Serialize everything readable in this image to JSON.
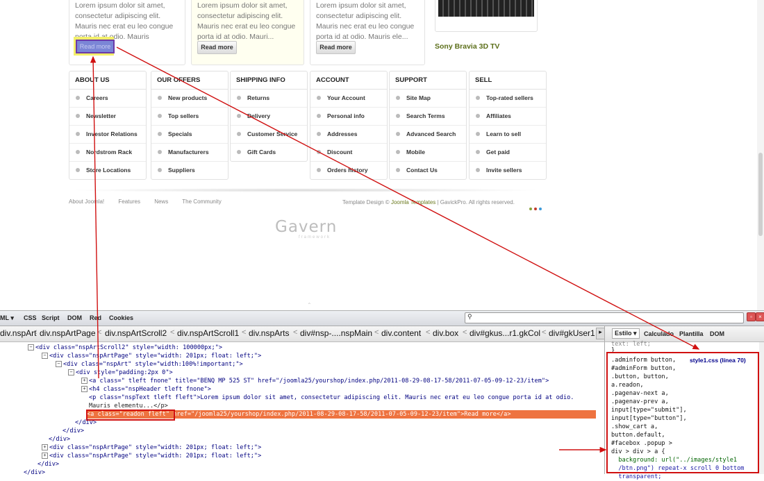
{
  "articles": [
    {
      "text": "Lorem ipsum dolor sit amet, consectetur adipiscing elit. Mauris nec erat eu leo congue porta id at odio. Mauris elementu...",
      "button": "Read more"
    },
    {
      "text": "Lorem ipsum dolor sit amet, consectetur adipiscing elit. Mauris nec erat eu leo congue porta id at odio. Mauri...",
      "button": "Read more"
    },
    {
      "text": "Lorem ipsum dolor sit amet, consectetur adipiscing elit. Mauris nec erat eu leo congue porta id at odio. Mauris ele...",
      "button": "Read more"
    }
  ],
  "product": {
    "title": "Sony Bravia 3D TV"
  },
  "footer_columns": [
    {
      "title": "ABOUT US",
      "items": [
        "Careers",
        "Newsletter",
        "Investor Relations",
        "Nordstrom Rack",
        "Store Locations"
      ]
    },
    {
      "title": "OUR OFFERS",
      "items": [
        "New products",
        "Top sellers",
        "Specials",
        "Manufacturers",
        "Suppliers"
      ]
    },
    {
      "title": "SHIPPING INFO",
      "items": [
        "Returns",
        "Delivery",
        "Customer Service",
        "Gift Cards"
      ]
    },
    {
      "title": "ACCOUNT",
      "items": [
        "Your Account",
        "Personal info",
        "Addresses",
        "Discount",
        "Orders history"
      ]
    },
    {
      "title": "SUPPORT",
      "items": [
        "Site Map",
        "Search Terms",
        "Advanced Search",
        "Mobile",
        "Contact Us"
      ]
    },
    {
      "title": "SELL",
      "items": [
        "Top-rated sellers",
        "Affiliates",
        "Learn to sell",
        "Get paid",
        "Invite sellers"
      ]
    }
  ],
  "footer_links": [
    "About Joomla!",
    "Features",
    "News",
    "The Community"
  ],
  "copyright": {
    "prefix": "Template Design © ",
    "link": "Joomla Templates",
    "suffix": " | GavickPro. All rights reserved."
  },
  "logo": {
    "name": "Gavern",
    "sub": "framework"
  },
  "colors": {
    "accent_red": "#d01010",
    "selection": "#ee7340",
    "dot1": "#8aa23a",
    "dot2": "#c0392b",
    "dot3": "#3a9ad9"
  },
  "firebug": {
    "toolbar_tabs": [
      "ML ▾",
      "CSS",
      "Script",
      "DOM",
      "Red",
      "Cookies"
    ],
    "breadcrumb": [
      "div.nspArt",
      "div.nspArtPage",
      "div.nspArtScroll2",
      "div.nspArtScroll1",
      "div.nspArts",
      "div#nsp-....nspMain",
      "div.content",
      "div.box",
      "div#gkus...r1.gkCol",
      "div#gkUser1"
    ],
    "side_tabs": [
      "Estilo ▾",
      "Calculado",
      "Plantilla",
      "DOM"
    ],
    "html_lines": [
      "<div class=\"nspArtScroll2\" style=\"width: 100000px;\">",
      "<div class=\"nspArtPage\" style=\"width: 201px; float: left;\">",
      "<div class=\"nspArt\" style=\"width:100%!important;\">",
      "<div style=\"padding:2px 0\">",
      "<a class=\" tleft fnone\" title=\"BENQ MP 525 ST\" href=\"/joomla25/yourshop/index.php/2011-08-29-08-17-58/2011-07-05-09-12-23/item\">",
      "<h4 class=\"nspHeader tleft fnone\">",
      "<p class=\"nspText tleft fleft\">Lorem ipsum dolor sit amet, consectetur adipiscing elit. Mauris nec erat eu leo congue porta id at odio.",
      "Mauris elementu...</p>",
      "<a class=\"readon fleft\" href=\"/joomla25/yourshop/index.php/2011-08-29-08-17-58/2011-07-05-09-12-23/item\">Read more</a>",
      "</div>",
      "</div>",
      "</div>",
      "<div class=\"nspArtPage\" style=\"width: 201px; float: left;\">",
      "<div class=\"nspArtPage\" style=\"width: 201px; float: left;\">",
      "</div>",
      "</div>"
    ],
    "css_top": [
      "text: left;",
      "}"
    ],
    "css_source": "style1.css (línea 70)",
    "css_rule": [
      ".adminform button,",
      "#adminForm button,",
      ".button, button,",
      "a.readon,",
      ".pagenav-next a,",
      ".pagenav-prev a,",
      "input[type=\"submit\"],",
      "input[type=\"button\"],",
      ".show_cart a,",
      "button.default,",
      "#facebox .popup >",
      "div > div > a {",
      "  background: url(\"../images/style1",
      "  /btn.png\") repeat-x scroll 0 bottom",
      "  transparent;",
      "}"
    ]
  }
}
